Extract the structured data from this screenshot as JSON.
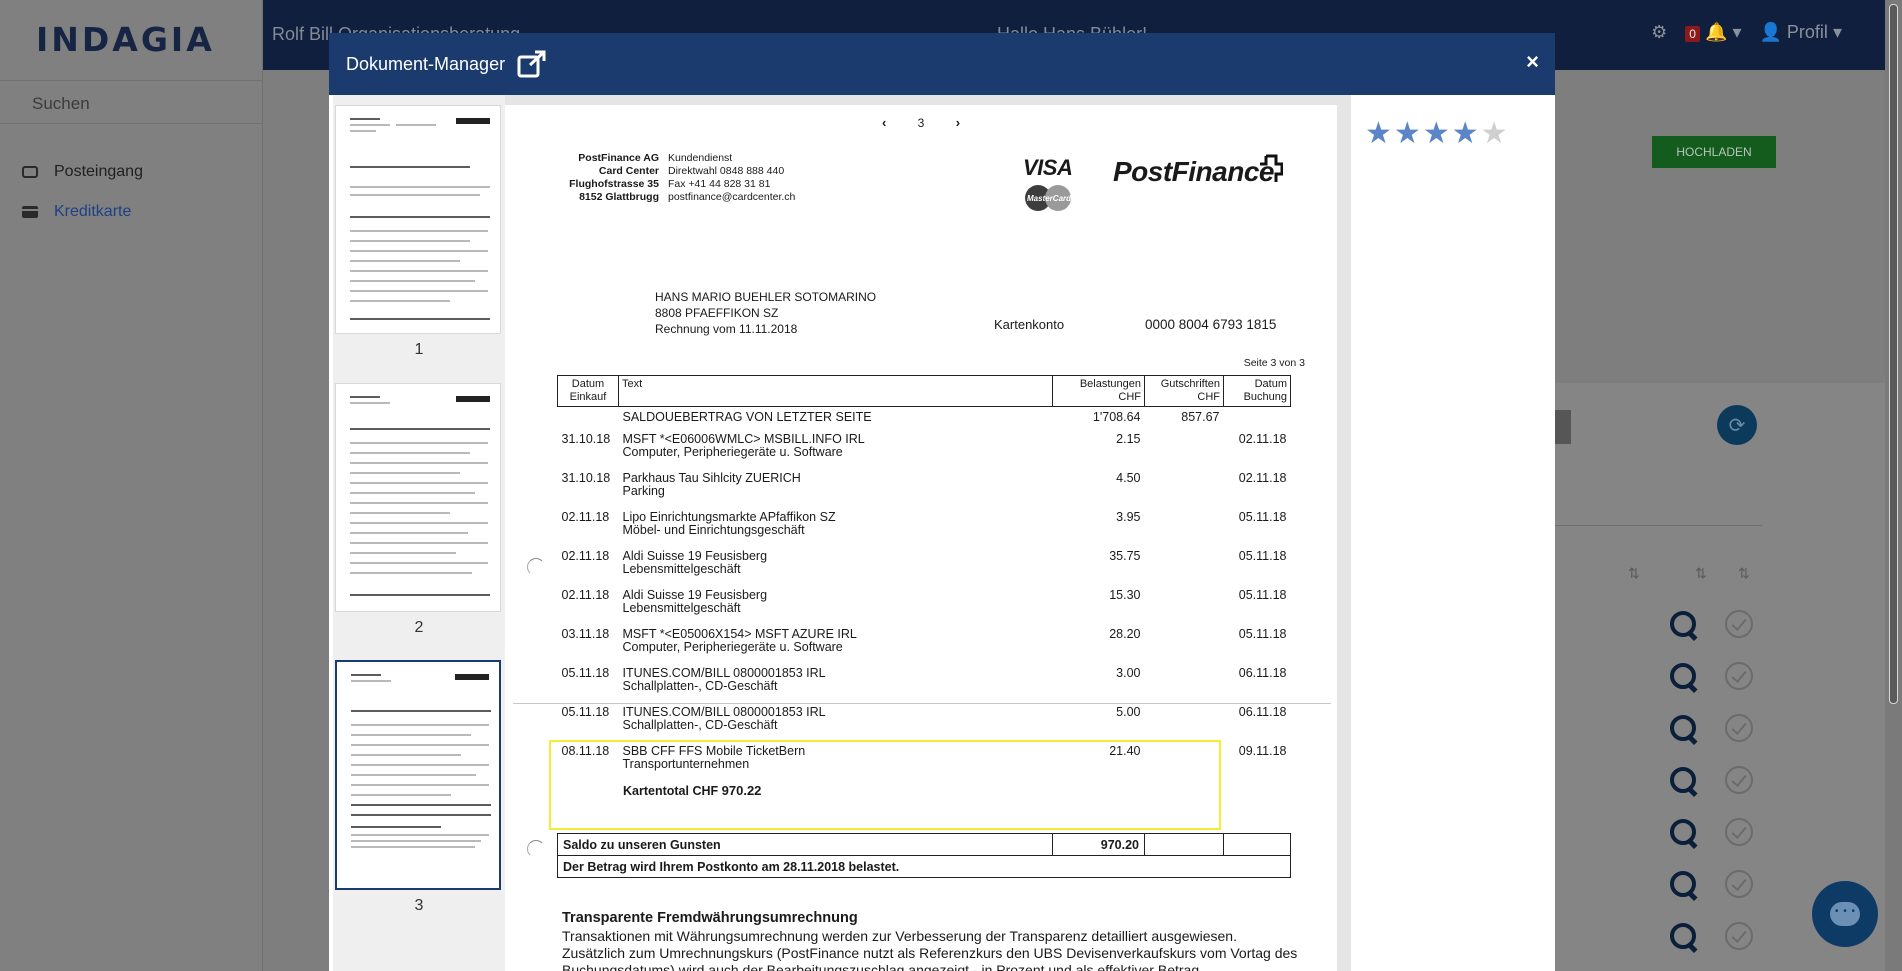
{
  "app": {
    "logo": "INDAGIA",
    "search_placeholder": "Suchen",
    "nav": [
      {
        "label": "Posteingang",
        "icon": "inbox-icon"
      },
      {
        "label": "Kreditkarte",
        "icon": "credit-card-icon",
        "active": true
      }
    ],
    "org_name": "Rolf Bill Organisationsberatung",
    "greeting": "Hallo Hans Bühler!",
    "notification_count": "0",
    "profile_label": "Profil",
    "upload_label": "HOCHLADEN"
  },
  "modal": {
    "title": "Dokument-Manager",
    "close_label": "×",
    "thumbnails": [
      {
        "label": "1"
      },
      {
        "label": "2"
      },
      {
        "label": "3",
        "active": true
      }
    ],
    "rating": {
      "value": 4,
      "max": 5
    },
    "pager": {
      "prev": "‹",
      "page": "3",
      "next": "›"
    }
  },
  "document": {
    "sender_lines": [
      "PostFinance AG",
      "Card Center",
      "Flughofstrasse 35",
      "8152 Glattbrugg"
    ],
    "contact_lines": [
      "Kundendienst",
      "Direktwahl 0848 888 440",
      "Fax  +41 44 828 31 81",
      "postfinance@cardcenter.ch"
    ],
    "visa": "VISA",
    "mastercard": "MasterCard",
    "brand": "PostFinance",
    "address_lines": [
      "HANS MARIO BUEHLER SOTOMARINO",
      "8808 PFAEFFIKON SZ",
      "Rechnung vom 11.11.2018"
    ],
    "konto_label": "Kartenkonto",
    "konto_number": "0000 8004 6793 1815",
    "page_info": "Seite 3 von 3",
    "headers": {
      "date": [
        "Datum",
        "Einkauf"
      ],
      "text": "Text",
      "debit": [
        "Belastungen",
        "CHF"
      ],
      "credit": [
        "Gutschriften",
        "CHF"
      ],
      "booking": [
        "Datum",
        "Buchung"
      ]
    },
    "carryover": {
      "text": "SALDOUEBERTRAG VON LETZTER SEITE",
      "debit": "1'708.64",
      "credit": "857.67"
    },
    "transactions": [
      {
        "date": "31.10.18",
        "text": "MSFT *<E06006WMLC> MSBILL.INFO IRL",
        "sub": "Computer, Peripheriegeräte u. Software",
        "debit": "2.15",
        "booking": "02.11.18"
      },
      {
        "date": "31.10.18",
        "text": "Parkhaus Tau Sihlcity ZUERICH",
        "sub": "Parking",
        "debit": "4.50",
        "booking": "02.11.18"
      },
      {
        "date": "02.11.18",
        "text": "Lipo Einrichtungsmarkte APfaffikon SZ",
        "sub": "Möbel- und Einrichtungsgeschäft",
        "debit": "3.95",
        "booking": "05.11.18"
      },
      {
        "date": "02.11.18",
        "text": "Aldi Suisse 19 Feusisberg",
        "sub": "Lebensmittelgeschäft",
        "debit": "35.75",
        "booking": "05.11.18"
      },
      {
        "date": "02.11.18",
        "text": "Aldi Suisse 19 Feusisberg",
        "sub": "Lebensmittelgeschäft",
        "debit": "15.30",
        "booking": "05.11.18"
      },
      {
        "date": "03.11.18",
        "text": "MSFT *<E05006X154> MSFT AZURE IRL",
        "sub": "Computer, Peripheriegeräte u. Software",
        "debit": "28.20",
        "booking": "05.11.18"
      },
      {
        "date": "05.11.18",
        "text": "ITUNES.COM/BILL 0800001853 IRL",
        "sub": "Schallplatten-, CD-Geschäft",
        "debit": "3.00",
        "booking": "06.11.18"
      },
      {
        "date": "05.11.18",
        "text": "ITUNES.COM/BILL 0800001853 IRL",
        "sub": "Schallplatten-, CD-Geschäft",
        "debit": "5.00",
        "booking": "06.11.18"
      },
      {
        "date": "08.11.18",
        "text": "SBB CFF FFS Mobile TicketBern",
        "sub": "Transportunternehmen",
        "debit": "21.40",
        "booking": "09.11.18"
      }
    ],
    "card_total_label": "Kartentotal CHF",
    "card_total_value": "970.22",
    "saldo_label": "Saldo zu unseren Gunsten",
    "saldo_value": "970.20",
    "postkonto_note": "Der Betrag wird Ihrem Postkonto am 28.11.2018 belastet.",
    "fx_title": "Transparente Fremdwährungsumrechnung",
    "fx_text": "Transaktionen mit Währungsumrechnung werden zur Verbesserung der Transparenz detailliert ausgewiesen. Zusätzlich zum Umrechnungskurs (PostFinance nutzt als Referenzkurs den UBS Devisenverkaufskurs vom Vortag des Buchungsdatums) wird auch der Bearbeitungszuschlag angezeigt - in Prozent und als effektiver Betrag."
  }
}
